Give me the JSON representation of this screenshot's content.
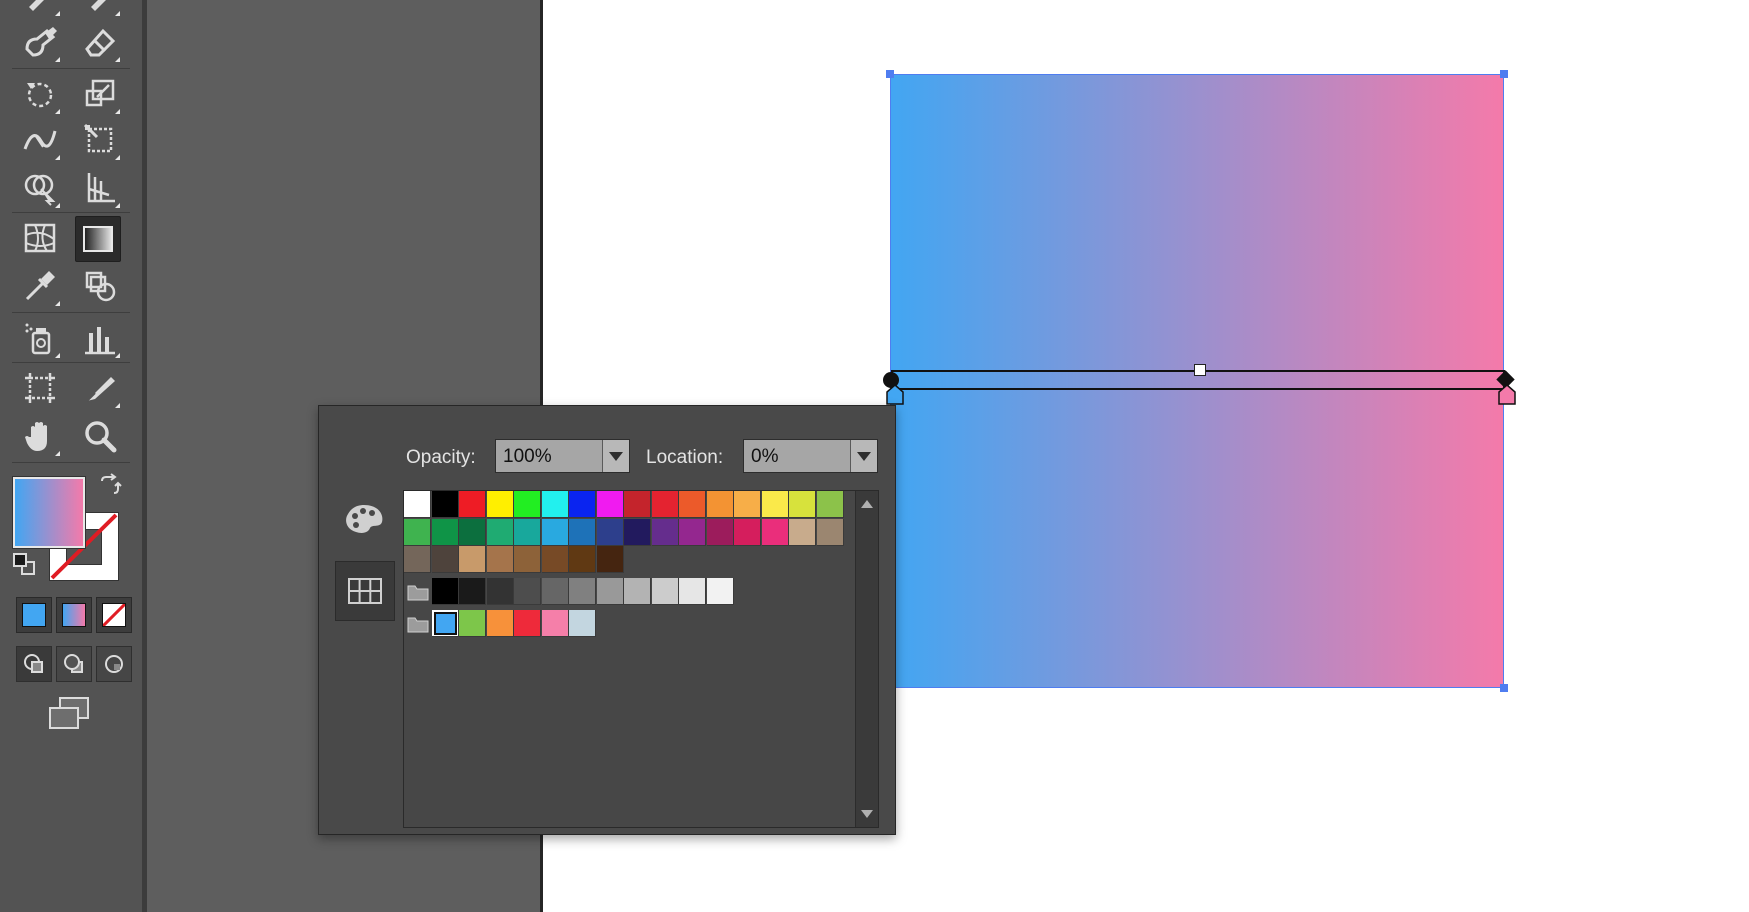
{
  "toolbar": {
    "tools": [
      {
        "name": "blob-brush-tool",
        "icon": "blob-brush-icon"
      },
      {
        "name": "eraser-tool",
        "icon": "eraser-icon"
      },
      {
        "name": "rotate-tool",
        "icon": "rotate-icon"
      },
      {
        "name": "scale-tool",
        "icon": "scale-icon"
      },
      {
        "name": "width-tool",
        "icon": "width-icon"
      },
      {
        "name": "free-transform-tool",
        "icon": "free-transform-icon"
      },
      {
        "name": "shape-builder-tool",
        "icon": "shape-builder-icon"
      },
      {
        "name": "perspective-grid-tool",
        "icon": "perspective-grid-icon"
      },
      {
        "name": "mesh-tool",
        "icon": "mesh-icon"
      },
      {
        "name": "gradient-tool",
        "icon": "gradient-icon",
        "active": true
      },
      {
        "name": "eyedropper-tool",
        "icon": "eyedropper-icon"
      },
      {
        "name": "blend-tool",
        "icon": "blend-icon"
      },
      {
        "name": "symbol-sprayer-tool",
        "icon": "symbol-sprayer-icon"
      },
      {
        "name": "column-graph-tool",
        "icon": "column-graph-icon"
      },
      {
        "name": "artboard-tool",
        "icon": "artboard-icon"
      },
      {
        "name": "slice-tool",
        "icon": "slice-icon"
      },
      {
        "name": "hand-tool",
        "icon": "hand-icon"
      },
      {
        "name": "zoom-tool",
        "icon": "zoom-icon"
      }
    ],
    "fill_gradient": [
      "#42a6f2",
      "#f47aaa"
    ],
    "color_modes": [
      "color",
      "gradient",
      "none"
    ],
    "draw_modes": [
      "draw-normal",
      "draw-behind",
      "draw-inside"
    ],
    "screen_mode": "change-screen-mode"
  },
  "stop_panel": {
    "opacity_label": "Opacity:",
    "opacity_value": "100%",
    "location_label": "Location:",
    "location_value": "0%",
    "swatch_rows": [
      [
        "#ffffff",
        "#000000",
        "#ee1c25",
        "#ffef00",
        "#22ee22",
        "#22f0ee",
        "#0a24f0",
        "#f01bf0",
        "#c4242c",
        "#e42330",
        "#ec5a2a",
        "#f39333",
        "#f7ae48",
        "#fae94a",
        "#d7e23c",
        "#8cc24a"
      ],
      [
        "#3fb34f",
        "#0f9447",
        "#0c6f3e",
        "#1fab72",
        "#18a89c",
        "#29a9e0",
        "#1e72b8",
        "#2d3f8c",
        "#221a5e",
        "#652d8d",
        "#94278f",
        "#9c1c5c",
        "#d51e5d",
        "#ea2e7b",
        "#c8ab8c",
        "#9b8670"
      ],
      [
        "#74665a",
        "#4e433c",
        "#c89a6a",
        "#a5744b",
        "#8d6239",
        "#774a26",
        "#603913",
        "#452510"
      ]
    ],
    "gray_group": [
      "#000000",
      "#1a1a1a",
      "#333333",
      "#4d4d4d",
      "#666666",
      "#808080",
      "#999999",
      "#b3b3b3",
      "#cccccc",
      "#e6e6e6",
      "#f2f2f2"
    ],
    "color_group": [
      "#42a6f2",
      "#7dc64a",
      "#f7913a",
      "#ee2a3a",
      "#f57fa9",
      "#c3d6e0"
    ],
    "selected_swatch": "#42a6f2"
  },
  "gradient_object": {
    "start_color": "#42a6f2",
    "end_color": "#f47aaa",
    "selection_color": "#4f7df0"
  }
}
